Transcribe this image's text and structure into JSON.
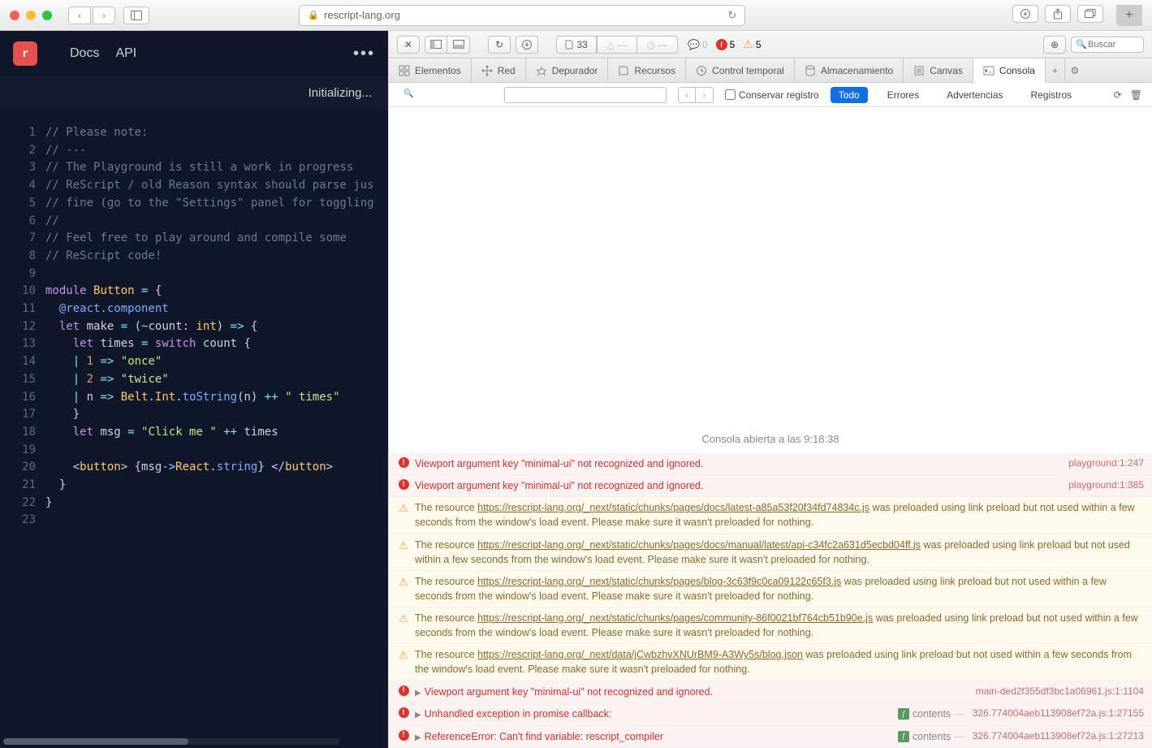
{
  "browser": {
    "url_host": "rescript-lang.org",
    "new_tab_label": "+"
  },
  "editor": {
    "nav": {
      "docs": "Docs",
      "api": "API"
    },
    "status": "Initializing...",
    "code_lines": [
      {
        "n": 1,
        "tokens": [
          {
            "c": "cm",
            "t": "// Please note:"
          }
        ]
      },
      {
        "n": 2,
        "tokens": [
          {
            "c": "cm",
            "t": "// ---"
          }
        ]
      },
      {
        "n": 3,
        "tokens": [
          {
            "c": "cm",
            "t": "// The Playground is still a work in progress"
          }
        ]
      },
      {
        "n": 4,
        "tokens": [
          {
            "c": "cm",
            "t": "// ReScript / old Reason syntax should parse jus"
          }
        ]
      },
      {
        "n": 5,
        "tokens": [
          {
            "c": "cm",
            "t": "// fine (go to the \"Settings\" panel for toggling"
          }
        ]
      },
      {
        "n": 6,
        "tokens": [
          {
            "c": "cm",
            "t": "//"
          }
        ]
      },
      {
        "n": 7,
        "tokens": [
          {
            "c": "cm",
            "t": "// Feel free to play around and compile some"
          }
        ]
      },
      {
        "n": 8,
        "tokens": [
          {
            "c": "cm",
            "t": "// ReScript code!"
          }
        ]
      },
      {
        "n": 9,
        "tokens": []
      },
      {
        "n": 10,
        "tokens": [
          {
            "c": "kw",
            "t": "module"
          },
          {
            "c": "id",
            "t": " "
          },
          {
            "c": "ty",
            "t": "Button"
          },
          {
            "c": "id",
            "t": " "
          },
          {
            "c": "op",
            "t": "="
          },
          {
            "c": "id",
            "t": " {"
          }
        ]
      },
      {
        "n": 11,
        "tokens": [
          {
            "c": "id",
            "t": "  "
          },
          {
            "c": "fn",
            "t": "@react.component"
          }
        ]
      },
      {
        "n": 12,
        "tokens": [
          {
            "c": "id",
            "t": "  "
          },
          {
            "c": "kw",
            "t": "let"
          },
          {
            "c": "id",
            "t": " make "
          },
          {
            "c": "op",
            "t": "="
          },
          {
            "c": "id",
            "t": " ("
          },
          {
            "c": "op",
            "t": "~"
          },
          {
            "c": "id",
            "t": "count: "
          },
          {
            "c": "ty",
            "t": "int"
          },
          {
            "c": "id",
            "t": ") "
          },
          {
            "c": "op",
            "t": "=>"
          },
          {
            "c": "id",
            "t": " {"
          }
        ]
      },
      {
        "n": 13,
        "tokens": [
          {
            "c": "id",
            "t": "    "
          },
          {
            "c": "kw",
            "t": "let"
          },
          {
            "c": "id",
            "t": " times "
          },
          {
            "c": "op",
            "t": "="
          },
          {
            "c": "id",
            "t": " "
          },
          {
            "c": "kw",
            "t": "switch"
          },
          {
            "c": "id",
            "t": " count {"
          }
        ]
      },
      {
        "n": 14,
        "tokens": [
          {
            "c": "id",
            "t": "    "
          },
          {
            "c": "op",
            "t": "|"
          },
          {
            "c": "id",
            "t": " "
          },
          {
            "c": "nm",
            "t": "1"
          },
          {
            "c": "id",
            "t": " "
          },
          {
            "c": "op",
            "t": "=>"
          },
          {
            "c": "id",
            "t": " "
          },
          {
            "c": "st",
            "t": "\"once\""
          }
        ]
      },
      {
        "n": 15,
        "tokens": [
          {
            "c": "id",
            "t": "    "
          },
          {
            "c": "op",
            "t": "|"
          },
          {
            "c": "id",
            "t": " "
          },
          {
            "c": "nm",
            "t": "2"
          },
          {
            "c": "id",
            "t": " "
          },
          {
            "c": "op",
            "t": "=>"
          },
          {
            "c": "id",
            "t": " "
          },
          {
            "c": "st",
            "t": "\"twice\""
          }
        ]
      },
      {
        "n": 16,
        "tokens": [
          {
            "c": "id",
            "t": "    "
          },
          {
            "c": "op",
            "t": "|"
          },
          {
            "c": "id",
            "t": " n "
          },
          {
            "c": "op",
            "t": "=>"
          },
          {
            "c": "id",
            "t": " "
          },
          {
            "c": "ty",
            "t": "Belt"
          },
          {
            "c": "id",
            "t": "."
          },
          {
            "c": "ty",
            "t": "Int"
          },
          {
            "c": "id",
            "t": "."
          },
          {
            "c": "fn",
            "t": "toString"
          },
          {
            "c": "id",
            "t": "(n) "
          },
          {
            "c": "op",
            "t": "++"
          },
          {
            "c": "id",
            "t": " "
          },
          {
            "c": "st",
            "t": "\" times\""
          }
        ]
      },
      {
        "n": 17,
        "tokens": [
          {
            "c": "id",
            "t": "    }"
          }
        ]
      },
      {
        "n": 18,
        "tokens": [
          {
            "c": "id",
            "t": "    "
          },
          {
            "c": "kw",
            "t": "let"
          },
          {
            "c": "id",
            "t": " msg "
          },
          {
            "c": "op",
            "t": "="
          },
          {
            "c": "id",
            "t": " "
          },
          {
            "c": "st",
            "t": "\"Click me \""
          },
          {
            "c": "id",
            "t": " "
          },
          {
            "c": "op",
            "t": "++"
          },
          {
            "c": "id",
            "t": " times"
          }
        ]
      },
      {
        "n": 19,
        "tokens": []
      },
      {
        "n": 20,
        "tokens": [
          {
            "c": "id",
            "t": "    <"
          },
          {
            "c": "ty",
            "t": "button"
          },
          {
            "c": "id",
            "t": "> {msg"
          },
          {
            "c": "op",
            "t": "->"
          },
          {
            "c": "ty",
            "t": "React"
          },
          {
            "c": "id",
            "t": "."
          },
          {
            "c": "fn",
            "t": "string"
          },
          {
            "c": "id",
            "t": "} </"
          },
          {
            "c": "ty",
            "t": "button"
          },
          {
            "c": "id",
            "t": ">"
          }
        ]
      },
      {
        "n": 21,
        "tokens": [
          {
            "c": "id",
            "t": "  }"
          }
        ]
      },
      {
        "n": 22,
        "tokens": [
          {
            "c": "id",
            "t": "}"
          }
        ]
      },
      {
        "n": 23,
        "tokens": []
      }
    ]
  },
  "devtools": {
    "toolbar": {
      "resource_count": "33",
      "error_count": "5",
      "warning_count": "5",
      "comment_count": "0",
      "search_placeholder": "Buscar"
    },
    "tabs": [
      {
        "label": "Elementos",
        "icon": "elements"
      },
      {
        "label": "Red",
        "icon": "network"
      },
      {
        "label": "Depurador",
        "icon": "debugger"
      },
      {
        "label": "Recursos",
        "icon": "resources"
      },
      {
        "label": "Control temporal",
        "icon": "timeline"
      },
      {
        "label": "Almacenamiento",
        "icon": "storage"
      },
      {
        "label": "Canvas",
        "icon": "canvas"
      },
      {
        "label": "Consola",
        "icon": "console",
        "active": true
      }
    ],
    "filter_bar": {
      "preserve_log": "Conservar registro",
      "all": "Todo",
      "errors": "Errores",
      "warnings": "Advertencias",
      "logs": "Registros"
    },
    "console_opened": "Consola abierta a las 9:18:38",
    "log_entries": [
      {
        "type": "err",
        "arrow": false,
        "msg": "Viewport argument key \"minimal-ui\" not recognized and ignored.",
        "loc": "playground:1:247"
      },
      {
        "type": "err",
        "arrow": false,
        "msg": "Viewport argument key \"minimal-ui\" not recognized and ignored.",
        "loc": "playground:1:385"
      },
      {
        "type": "warn",
        "arrow": false,
        "pre": "The resource ",
        "link": "https://rescript-lang.org/_next/static/chunks/pages/docs/latest-a85a53f20f34fd74834c.js",
        "post": " was preloaded using link preload but not used within a few seconds from the window's load event. Please make sure it wasn't preloaded for nothing."
      },
      {
        "type": "warn",
        "arrow": false,
        "pre": "The resource ",
        "link": "https://rescript-lang.org/_next/static/chunks/pages/docs/manual/latest/api-c34fc2a631d5ecbd04ff.js",
        "post": " was preloaded using link preload but not used within a few seconds from the window's load event. Please make sure it wasn't preloaded for nothing."
      },
      {
        "type": "warn",
        "arrow": false,
        "pre": "The resource ",
        "link": "https://rescript-lang.org/_next/static/chunks/pages/blog-3c63f9c0ca09122c65f3.js",
        "post": " was preloaded using link preload but not used within a few seconds from the window's load event. Please make sure it wasn't preloaded for nothing."
      },
      {
        "type": "warn",
        "arrow": false,
        "pre": "The resource ",
        "link": "https://rescript-lang.org/_next/static/chunks/pages/community-86f0021bf764cb51b90e.js",
        "post": " was preloaded using link preload but not used within a few seconds from the window's load event. Please make sure it wasn't preloaded for nothing."
      },
      {
        "type": "warn",
        "arrow": false,
        "pre": "The resource ",
        "link": "https://rescript-lang.org/_next/data/jCwbzhvXNUrBM9-A3Wy5s/blog.json",
        "post": " was preloaded using link preload but not used within a few seconds from the window's load event. Please make sure it wasn't preloaded for nothing."
      },
      {
        "type": "err",
        "arrow": true,
        "msg": "Viewport argument key \"minimal-ui\" not recognized and ignored.",
        "loc": "main-ded2f355df3bc1a06961.js:1:1104"
      },
      {
        "type": "err",
        "arrow": true,
        "msg": "Unhandled exception in promise callback:",
        "extra": {
          "badge": "f",
          "text": "contents"
        },
        "loc": "326.774004aeb113908ef72a.js:1:27155"
      },
      {
        "type": "err",
        "arrow": true,
        "msg": "ReferenceError: Can't find variable: rescript_compiler",
        "extra": {
          "badge": "f",
          "text": "contents"
        },
        "loc": "326.774004aeb113908ef72a.js:1:27213"
      }
    ]
  }
}
